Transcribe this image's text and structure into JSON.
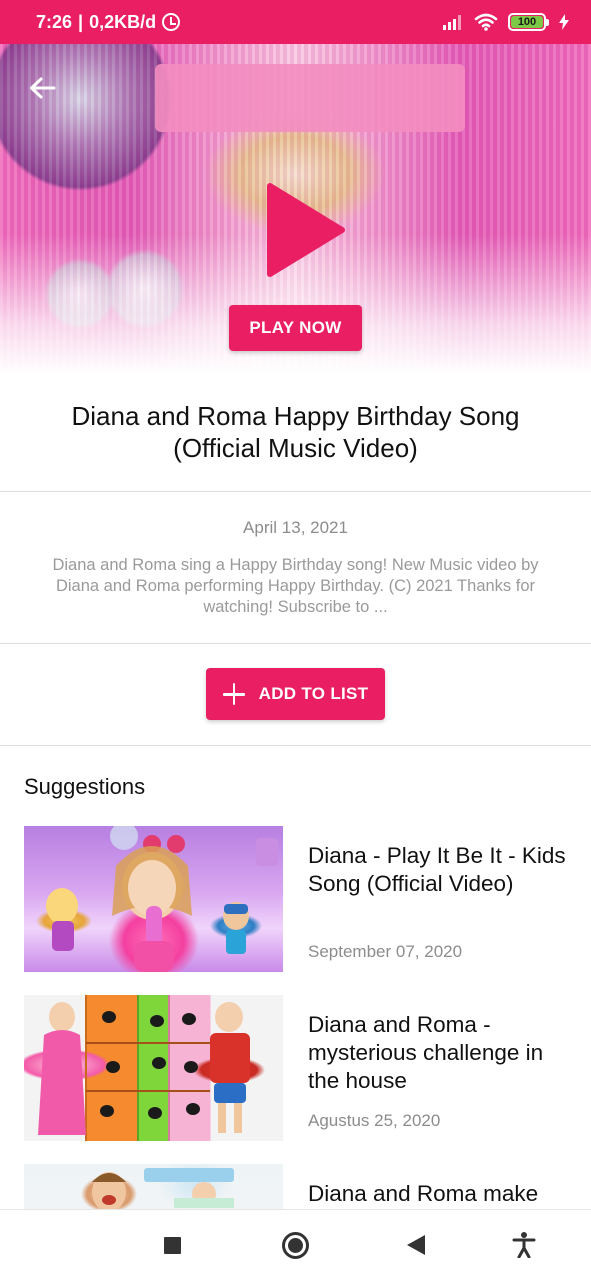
{
  "status_bar": {
    "time": "7:26",
    "separator": "|",
    "data_rate": "0,2KB/d",
    "battery_level": "100",
    "battery_color": "#7bc944",
    "background_color": "#e91e63",
    "icons": [
      "alarm-icon",
      "signal-icon",
      "wifi-icon",
      "battery-icon",
      "charging-icon"
    ]
  },
  "hero": {
    "back_icon": "arrow-left-icon",
    "play_icon": "play-icon",
    "play_now_label": "PLAY NOW"
  },
  "video": {
    "title": "Diana and Roma Happy Birthday Song (Official Music Video)",
    "date": "April 13, 2021",
    "description": "Diana and Roma sing a Happy Birthday song! New Music video by Diana and Roma performing Happy Birthday. (C) 2021 Thanks for watching! Subscribe to ..."
  },
  "actions": {
    "add_to_list_label": "ADD TO LIST",
    "add_icon": "plus-icon",
    "accent_color": "#e91e63"
  },
  "suggestions": {
    "heading": "Suggestions",
    "items": [
      {
        "title": "Diana - Play It Be It - Kids Song (Official Video)",
        "date": "September 07, 2020"
      },
      {
        "title": "Diana and Roma - mysterious challenge in the house",
        "date": "Agustus 25, 2020"
      },
      {
        "title": "Diana and Roma make",
        "date": ""
      }
    ]
  },
  "nav_bar": {
    "icons": [
      "recents-square-icon",
      "home-circle-icon",
      "back-triangle-icon",
      "accessibility-icon"
    ]
  }
}
